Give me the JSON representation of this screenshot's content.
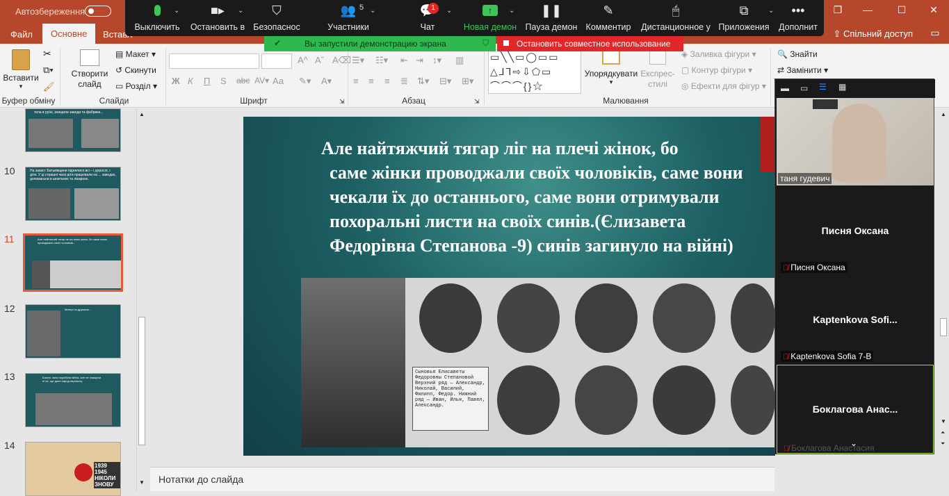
{
  "titlebar": {
    "autosave_label": "Автозбереження",
    "restore_icon": "❐",
    "close_icon": "✕",
    "minimize_icon": "—",
    "maximize_icon": "☐"
  },
  "tabs": {
    "file": "Файл",
    "home": "Основне",
    "insert": "Вставл",
    "share": "Спільний доступ"
  },
  "ribbon": {
    "clipboard": {
      "paste": "Вставити",
      "label": "Буфер обміну"
    },
    "slides": {
      "new_slide": "Створити слайд",
      "layout": "Макет",
      "reset": "Скинути",
      "section": "Розділ",
      "label": "Слайди"
    },
    "font": {
      "label": "Шрифт",
      "bold": "Ж",
      "italic": "К",
      "underline": "П",
      "strike": "S",
      "aa": "Аа"
    },
    "paragraph": {
      "label": "Абзац"
    },
    "drawing": {
      "arrange": "Упорядкувати",
      "quick_styles": "Експрес-стилі",
      "fill": "Заливка фігури",
      "outline": "Контур фігури",
      "effects": "Ефекти для фігур",
      "label": "Малювання"
    },
    "editing": {
      "find": "Знайти",
      "replace": "Замінити"
    }
  },
  "zoom": {
    "items": [
      {
        "label": "Выключить",
        "icon": "mic-icon"
      },
      {
        "label": "Остановить в",
        "icon": "video-icon"
      },
      {
        "label": "Безопаснос",
        "icon": "shield-icon"
      },
      {
        "label": "Участники",
        "icon": "participants-icon",
        "count": "5"
      },
      {
        "label": "Чат",
        "icon": "chat-icon",
        "badge": "1"
      },
      {
        "label": "Новая демон",
        "icon": "share-screen-icon"
      },
      {
        "label": "Пауза демон",
        "icon": "pause-icon"
      },
      {
        "label": "Комментир",
        "icon": "annotate-icon"
      },
      {
        "label": "Дистанционное у",
        "icon": "remote-control-icon"
      },
      {
        "label": "Приложения",
        "icon": "apps-icon"
      },
      {
        "label": "Дополнит",
        "icon": "more-icon"
      }
    ],
    "sharing_banner": "Вы запустили демонстрацию экрана",
    "stop_banner": "Остановить совместное использование"
  },
  "slides_panel": {
    "slides": [
      {
        "num": "",
        "caption": "тела в руїні, знищили заводи та фабрики..."
      },
      {
        "num": "10",
        "caption": "На захист Батьківщини піднялися всі – і дорослі, і діти. У ці страшні часи діти працювали на ... заводах, допомагали в шпиталях та лікарнях."
      },
      {
        "num": "11",
        "caption": "Але найтяжчий тягар ліг на плечі жінок, бо саме жінки проводжали своїх чоловіків..."
      },
      {
        "num": "12",
        "caption": "Матері та дружини..."
      },
      {
        "num": "13",
        "caption": "Багато лиха наробила війна, але не знищили ні не, ще дали народ перемогу."
      },
      {
        "num": "14",
        "caption": "1939 1945 НІКОЛИ ЗНОВУ"
      }
    ]
  },
  "slide": {
    "text_first": "Але найтяжчий тягар ліг на плечі жінок, бо",
    "text_rest": "саме жінки проводжали своїх чоловіків, саме вони чекали їх до останнього, саме вони отримували похоральні листи на своїх синів.(Єлизавета Федорівна Степанова -9) синів загинуло на війні)",
    "photo_caption": "Сыновья Елисаветы Федоровны Степановой Верхний ряд — Александр, Николай, Василий, Филипп, Федор. Нижний ряд — Иван, Илья, Павел, Александр."
  },
  "notes": {
    "placeholder": "Нотатки до слайда"
  },
  "participants": {
    "tiles": [
      {
        "name": "",
        "label": "таня гудевич",
        "muted": false,
        "video": true
      },
      {
        "name": "Писня Оксана",
        "label": "Писня Оксана",
        "muted": true
      },
      {
        "name": "Kaptenkova  Sofi...",
        "label": "Kaptenkova Sofia 7-В",
        "muted": true
      },
      {
        "name": "Боклагова  Анас...",
        "label": "Боклагова Анастасия",
        "muted": true
      }
    ]
  },
  "colors": {
    "accent": "#b7472a",
    "zoom_bg": "#1a1a1a",
    "share_green": "#2fb84f",
    "stop_red": "#e0282a"
  }
}
